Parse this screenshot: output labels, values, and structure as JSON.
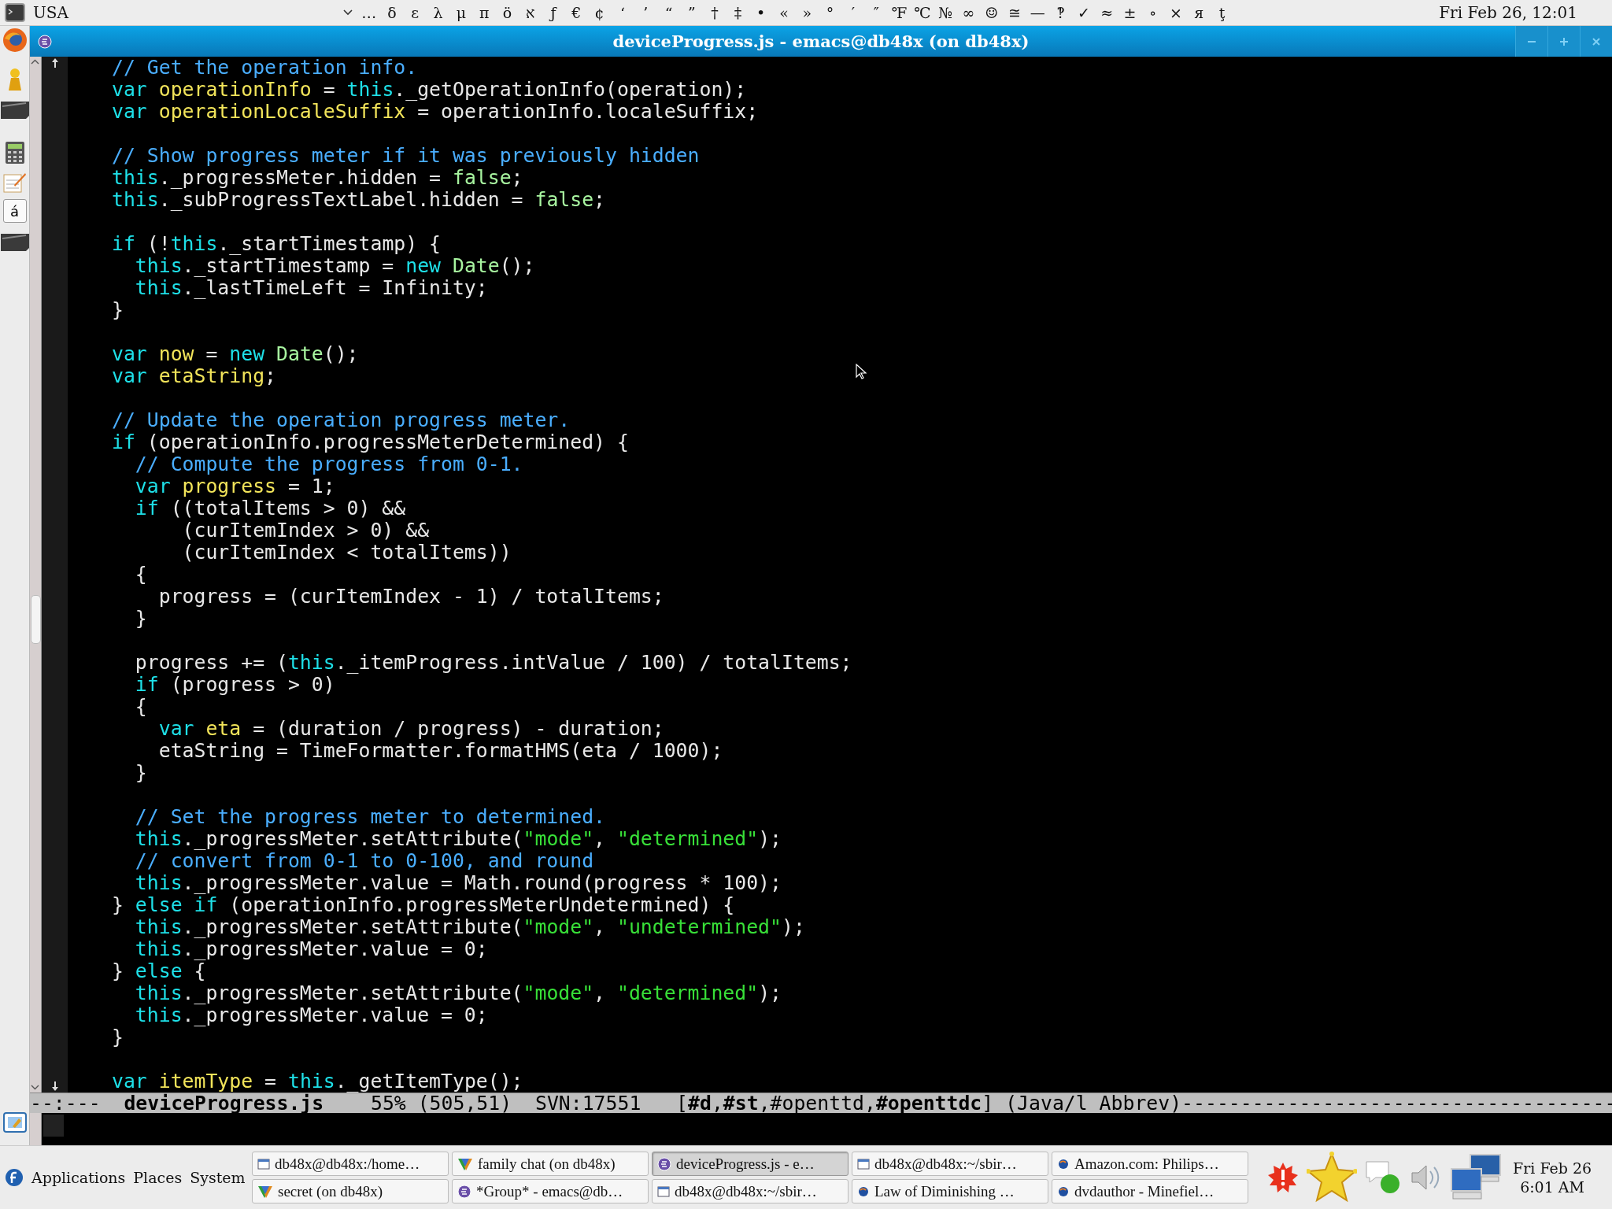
{
  "top_panel": {
    "keyboard_layout": "USA",
    "characters": [
      "…",
      "δ",
      "ε",
      "λ",
      "μ",
      "π",
      "ö",
      "א",
      "ƒ",
      "€",
      "¢",
      "‘",
      "’",
      "“",
      "”",
      "†",
      "‡",
      "•",
      "«",
      "»",
      "°",
      "′",
      "″",
      "℉",
      "℃",
      "№",
      "∞",
      "☺",
      "≅",
      "—",
      "‽",
      "✓",
      "≈",
      "±",
      "∘",
      "×",
      "я",
      "ţ"
    ],
    "clock": "Fri Feb 26, 12:01"
  },
  "launcher": {
    "key_label": "á"
  },
  "window": {
    "title": "deviceProgress.js - emacs@db48x (on db48x)"
  },
  "editor": {
    "lines": [
      {
        "kind": "code",
        "tokens": [
          {
            "kind": "comment",
            "text": "// Get the operation info."
          }
        ]
      },
      {
        "kind": "code",
        "tokens": [
          {
            "kind": "keyword",
            "text": "var"
          },
          {
            "kind": "variable",
            "text": " operationInfo"
          },
          {
            "kind": "plain",
            "text": " = "
          },
          {
            "kind": "keyword",
            "text": "this"
          },
          {
            "kind": "plain",
            "text": "._getOperationInfo(operation);"
          }
        ]
      },
      {
        "kind": "code",
        "tokens": [
          {
            "kind": "keyword",
            "text": "var"
          },
          {
            "kind": "variable",
            "text": " operationLocaleSuffix"
          },
          {
            "kind": "plain",
            "text": " = operationInfo.localeSuffix;"
          }
        ]
      },
      {
        "kind": "blank"
      },
      {
        "kind": "code",
        "tokens": [
          {
            "kind": "comment",
            "text": "// Show progress meter if it was previously hidden"
          }
        ]
      },
      {
        "kind": "code",
        "tokens": [
          {
            "kind": "keyword",
            "text": "this"
          },
          {
            "kind": "plain",
            "text": "._progressMeter.hidden = "
          },
          {
            "kind": "constant",
            "text": "false"
          },
          {
            "kind": "plain",
            "text": ";"
          }
        ]
      },
      {
        "kind": "code",
        "tokens": [
          {
            "kind": "keyword",
            "text": "this"
          },
          {
            "kind": "plain",
            "text": "._subProgressTextLabel.hidden = "
          },
          {
            "kind": "constant",
            "text": "false"
          },
          {
            "kind": "plain",
            "text": ";"
          }
        ]
      },
      {
        "kind": "blank"
      },
      {
        "kind": "code",
        "tokens": [
          {
            "kind": "keyword",
            "text": "if"
          },
          {
            "kind": "plain",
            "text": " (!"
          },
          {
            "kind": "keyword",
            "text": "this"
          },
          {
            "kind": "plain",
            "text": "._startTimestamp) {"
          }
        ]
      },
      {
        "kind": "code",
        "tokens": [
          {
            "kind": "keyword",
            "text": "  this"
          },
          {
            "kind": "plain",
            "text": "._startTimestamp = "
          },
          {
            "kind": "keyword",
            "text": "new"
          },
          {
            "kind": "constant",
            "text": " Date"
          },
          {
            "kind": "plain",
            "text": "();"
          }
        ]
      },
      {
        "kind": "code",
        "tokens": [
          {
            "kind": "keyword",
            "text": "  this"
          },
          {
            "kind": "plain",
            "text": "._lastTimeLeft = Infinity;"
          }
        ]
      },
      {
        "kind": "code",
        "tokens": [
          {
            "kind": "plain",
            "text": "}"
          }
        ]
      },
      {
        "kind": "blank"
      },
      {
        "kind": "code",
        "tokens": [
          {
            "kind": "keyword",
            "text": "var"
          },
          {
            "kind": "variable",
            "text": " now"
          },
          {
            "kind": "plain",
            "text": " = "
          },
          {
            "kind": "keyword",
            "text": "new"
          },
          {
            "kind": "constant",
            "text": " Date"
          },
          {
            "kind": "plain",
            "text": "();"
          }
        ]
      },
      {
        "kind": "code",
        "tokens": [
          {
            "kind": "keyword",
            "text": "var"
          },
          {
            "kind": "variable",
            "text": " etaString"
          },
          {
            "kind": "plain",
            "text": ";"
          }
        ]
      },
      {
        "kind": "blank"
      },
      {
        "kind": "code",
        "tokens": [
          {
            "kind": "comment",
            "text": "// Update the operation progress meter."
          }
        ]
      },
      {
        "kind": "code",
        "tokens": [
          {
            "kind": "keyword",
            "text": "if"
          },
          {
            "kind": "plain",
            "text": " (operationInfo.progressMeterDetermined) {"
          }
        ]
      },
      {
        "kind": "code",
        "tokens": [
          {
            "kind": "comment",
            "text": "  // Compute the progress from 0-1."
          }
        ]
      },
      {
        "kind": "code",
        "tokens": [
          {
            "kind": "keyword",
            "text": "  var"
          },
          {
            "kind": "variable",
            "text": " progress"
          },
          {
            "kind": "plain",
            "text": " = 1;"
          }
        ]
      },
      {
        "kind": "code",
        "tokens": [
          {
            "kind": "keyword",
            "text": "  if"
          },
          {
            "kind": "plain",
            "text": " ((totalItems > 0) &&"
          }
        ]
      },
      {
        "kind": "code",
        "tokens": [
          {
            "kind": "plain",
            "text": "      (curItemIndex > 0) &&"
          }
        ]
      },
      {
        "kind": "code",
        "tokens": [
          {
            "kind": "plain",
            "text": "      (curItemIndex < totalItems))"
          }
        ]
      },
      {
        "kind": "code",
        "tokens": [
          {
            "kind": "plain",
            "text": "  {"
          }
        ]
      },
      {
        "kind": "code",
        "tokens": [
          {
            "kind": "plain",
            "text": "    progress = (curItemIndex - 1) / totalItems;"
          }
        ]
      },
      {
        "kind": "code",
        "tokens": [
          {
            "kind": "plain",
            "text": "  }"
          }
        ]
      },
      {
        "kind": "blank"
      },
      {
        "kind": "code",
        "tokens": [
          {
            "kind": "plain",
            "text": "  progress += ("
          },
          {
            "kind": "keyword",
            "text": "this"
          },
          {
            "kind": "plain",
            "text": "._itemProgress.intValue / 100) / totalItems;"
          }
        ]
      },
      {
        "kind": "code",
        "tokens": [
          {
            "kind": "keyword",
            "text": "  if"
          },
          {
            "kind": "plain",
            "text": " (progress > 0)"
          }
        ]
      },
      {
        "kind": "code",
        "tokens": [
          {
            "kind": "plain",
            "text": "  {"
          }
        ]
      },
      {
        "kind": "code",
        "tokens": [
          {
            "kind": "keyword",
            "text": "    var"
          },
          {
            "kind": "variable",
            "text": " eta"
          },
          {
            "kind": "plain",
            "text": " = (duration / progress) - duration;"
          }
        ]
      },
      {
        "kind": "code",
        "tokens": [
          {
            "kind": "plain",
            "text": "    etaString = TimeFormatter.formatHMS(eta / 1000);"
          }
        ]
      },
      {
        "kind": "code",
        "tokens": [
          {
            "kind": "plain",
            "text": "  }"
          }
        ]
      },
      {
        "kind": "blank"
      },
      {
        "kind": "code",
        "tokens": [
          {
            "kind": "comment",
            "text": "  // Set the progress meter to determined."
          }
        ]
      },
      {
        "kind": "code",
        "tokens": [
          {
            "kind": "keyword",
            "text": "  this"
          },
          {
            "kind": "plain",
            "text": "._progressMeter.setAttribute("
          },
          {
            "kind": "string",
            "text": "\"mode\""
          },
          {
            "kind": "plain",
            "text": ", "
          },
          {
            "kind": "string",
            "text": "\"determined\""
          },
          {
            "kind": "plain",
            "text": ");"
          }
        ]
      },
      {
        "kind": "code",
        "tokens": [
          {
            "kind": "comment",
            "text": "  // convert from 0-1 to 0-100, and round"
          }
        ]
      },
      {
        "kind": "code",
        "tokens": [
          {
            "kind": "keyword",
            "text": "  this"
          },
          {
            "kind": "plain",
            "text": "._progressMeter.value = Math.round(progress * 100);"
          }
        ]
      },
      {
        "kind": "code",
        "tokens": [
          {
            "kind": "plain",
            "text": "} "
          },
          {
            "kind": "keyword",
            "text": "else if"
          },
          {
            "kind": "plain",
            "text": " (operationInfo.progressMeterUndetermined) {"
          }
        ]
      },
      {
        "kind": "code",
        "tokens": [
          {
            "kind": "keyword",
            "text": "  this"
          },
          {
            "kind": "plain",
            "text": "._progressMeter.setAttribute("
          },
          {
            "kind": "string",
            "text": "\"mode\""
          },
          {
            "kind": "plain",
            "text": ", "
          },
          {
            "kind": "string",
            "text": "\"undetermined\""
          },
          {
            "kind": "plain",
            "text": ");"
          }
        ]
      },
      {
        "kind": "code",
        "tokens": [
          {
            "kind": "keyword",
            "text": "  this"
          },
          {
            "kind": "plain",
            "text": "._progressMeter.value = 0;"
          }
        ]
      },
      {
        "kind": "code",
        "tokens": [
          {
            "kind": "plain",
            "text": "} "
          },
          {
            "kind": "keyword",
            "text": "else"
          },
          {
            "kind": "plain",
            "text": " {"
          }
        ]
      },
      {
        "kind": "code",
        "tokens": [
          {
            "kind": "keyword",
            "text": "  this"
          },
          {
            "kind": "plain",
            "text": "._progressMeter.setAttribute("
          },
          {
            "kind": "string",
            "text": "\"mode\""
          },
          {
            "kind": "plain",
            "text": ", "
          },
          {
            "kind": "string",
            "text": "\"determined\""
          },
          {
            "kind": "plain",
            "text": ");"
          }
        ]
      },
      {
        "kind": "code",
        "tokens": [
          {
            "kind": "keyword",
            "text": "  this"
          },
          {
            "kind": "plain",
            "text": "._progressMeter.value = 0;"
          }
        ]
      },
      {
        "kind": "code",
        "tokens": [
          {
            "kind": "plain",
            "text": "}"
          }
        ]
      },
      {
        "kind": "blank"
      },
      {
        "kind": "code",
        "tokens": [
          {
            "kind": "keyword",
            "text": "var"
          },
          {
            "kind": "variable",
            "text": " itemType"
          },
          {
            "kind": "plain",
            "text": " = "
          },
          {
            "kind": "keyword",
            "text": "this"
          },
          {
            "kind": "plain",
            "text": "._getItemType();"
          }
        ]
      }
    ],
    "mode_line": "--:---  **deviceProgress.js**    55% (505,51)  SVN:17551   [**#d**,**#st**,#openttd,**#openttdc**] (Java/l Abbrev)-------------------------------------"
  },
  "taskbar": {
    "menus": [
      "Applications",
      "Places",
      "System"
    ],
    "tasks": [
      {
        "label": "db48x@db48x:/home…",
        "kind": "terminal",
        "selected": false
      },
      {
        "label": "family chat (on db48x)",
        "kind": "chat",
        "selected": false
      },
      {
        "label": "deviceProgress.js - e…",
        "kind": "emacs",
        "selected": true
      },
      {
        "label": "db48x@db48x:~/sbir…",
        "kind": "terminal",
        "selected": false
      },
      {
        "label": "Amazon.com: Philips…",
        "kind": "browser",
        "selected": false
      },
      {
        "label": "secret (on db48x)",
        "kind": "chat",
        "selected": false
      },
      {
        "label": "*Group* - emacs@db…",
        "kind": "emacs",
        "selected": false
      },
      {
        "label": "db48x@db48x:~/sbir…",
        "kind": "terminal",
        "selected": false
      },
      {
        "label": "Law of Diminishing …",
        "kind": "browser",
        "selected": false
      },
      {
        "label": "dvdauthor - Minefiel…",
        "kind": "browser",
        "selected": false
      }
    ],
    "clock": {
      "date": "Fri Feb 26",
      "time": "6:01 AM"
    }
  }
}
